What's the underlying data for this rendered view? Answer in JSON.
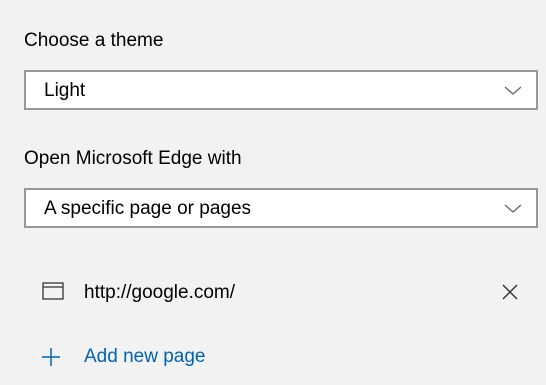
{
  "theme": {
    "label": "Choose a theme",
    "selected": "Light"
  },
  "startup": {
    "label": "Open Microsoft Edge with",
    "selected": "A specific page or pages"
  },
  "pages": [
    {
      "url": "http://google.com/"
    }
  ],
  "add_page": {
    "label": "Add new page"
  },
  "colors": {
    "accent": "#0063b1",
    "background": "#f2f2f2",
    "border": "#999999"
  },
  "icons": {
    "dropdown": "chevron-down-icon",
    "page": "browser-window-icon",
    "remove": "close-icon",
    "add": "plus-icon"
  }
}
